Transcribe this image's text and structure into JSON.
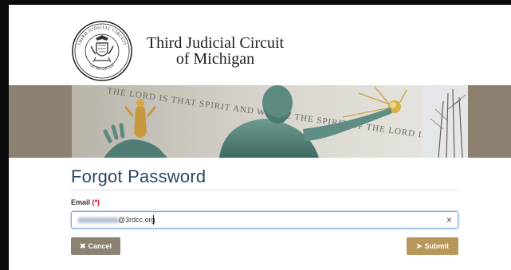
{
  "site": {
    "title_line1": "Third Judicial Circuit",
    "title_line2": "of Michigan",
    "seal_text_top": "THIRD JUDICIAL CIRCUIT",
    "seal_text_bottom": "OF MICHIGAN"
  },
  "banner": {
    "inscription": "THE LORD IS THAT SPIRIT AND WHERE THE SPIRIT OF THE LORD IS THERE IS LIBERTY"
  },
  "form": {
    "title": "Forgot Password",
    "email_label": "Email",
    "required_marker": "(*)",
    "email_value": "@3rdcc.org",
    "clear_label": "×"
  },
  "buttons": {
    "cancel_label": "Cancel",
    "cancel_icon": "✖",
    "submit_label": "Submit",
    "submit_icon": "➤"
  },
  "icons": {
    "seal": "court-seal-icon",
    "cancel": "close-icon",
    "submit": "paper-plane-icon",
    "clear": "clear-icon"
  },
  "colors": {
    "title": "#2a4663",
    "banner_bg": "#8c8170",
    "cancel_button": "#8b8271",
    "submit_button": "#b8975b",
    "required": "#d0021b",
    "input_focus": "#7aa6d8"
  }
}
